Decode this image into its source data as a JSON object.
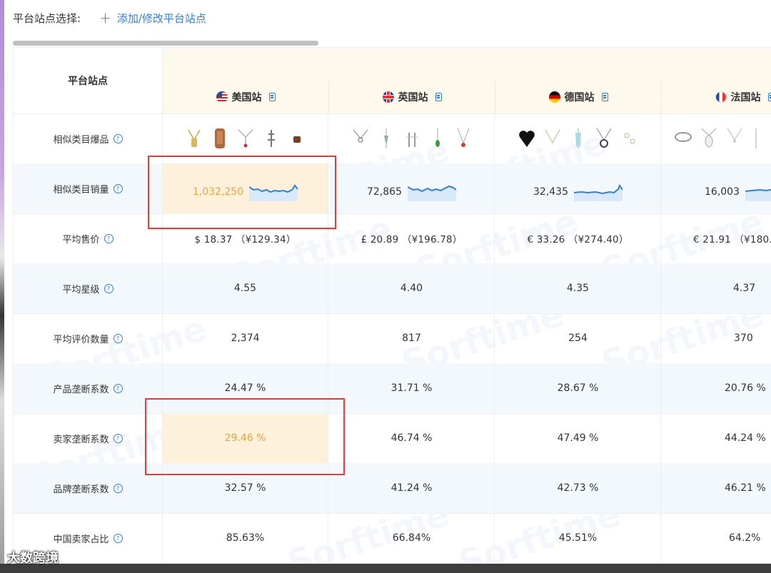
{
  "topbar": {
    "label": "平台站点选择:",
    "add_link": "添加/修改平台站点",
    "plus": "+"
  },
  "table": {
    "corner_header": "平台站点",
    "sites": [
      {
        "name": "美国站",
        "flag": "us-flag-icon"
      },
      {
        "name": "英国站",
        "flag": "uk-flag-icon"
      },
      {
        "name": "德国站",
        "flag": "de-flag-icon"
      },
      {
        "name": "法国站",
        "flag": "fr-flag-icon"
      }
    ],
    "rows": {
      "hot_products": {
        "label": "相似类目爆品"
      },
      "sales": {
        "label": "相似类目销量",
        "values": [
          "1,032,250",
          "72,865",
          "32,435",
          "16,003"
        ]
      },
      "avg_price": {
        "label": "平均售价",
        "values": [
          "$ 18.37  （¥129.34）",
          "£ 20.89  （¥196.78）",
          "€ 33.26  （¥274.40）",
          "€ 21.91  （¥180."
        ]
      },
      "avg_rating": {
        "label": "平均星级",
        "values": [
          "4.55",
          "4.40",
          "4.35",
          "4.37"
        ]
      },
      "avg_reviews": {
        "label": "平均评价数量",
        "values": [
          "2,374",
          "817",
          "254",
          "370"
        ]
      },
      "product_monopoly": {
        "label": "产品垄断系数",
        "values": [
          "24.47 %",
          "31.71 %",
          "28.67 %",
          "20.76 %"
        ]
      },
      "seller_monopoly": {
        "label": "卖家垄断系数",
        "values": [
          "29.46 %",
          "46.74 %",
          "47.49 %",
          "44.24 %"
        ]
      },
      "brand_monopoly": {
        "label": "品牌垄断系数",
        "values": [
          "32.57 %",
          "41.24 %",
          "42.73 %",
          "46.21 %"
        ]
      },
      "china_seller_share": {
        "label": "中国卖家占比",
        "values": [
          "85.63%",
          "66.84%",
          "45.51%",
          "64.2%"
        ]
      }
    },
    "help_icon": "?",
    "highlight_color": "#fdf1dc",
    "highlight_text_color": "#e8a33d",
    "annotation_color": "#e23d3d"
  },
  "watermark": "Sorftime",
  "corner_logo": "大数跨境"
}
